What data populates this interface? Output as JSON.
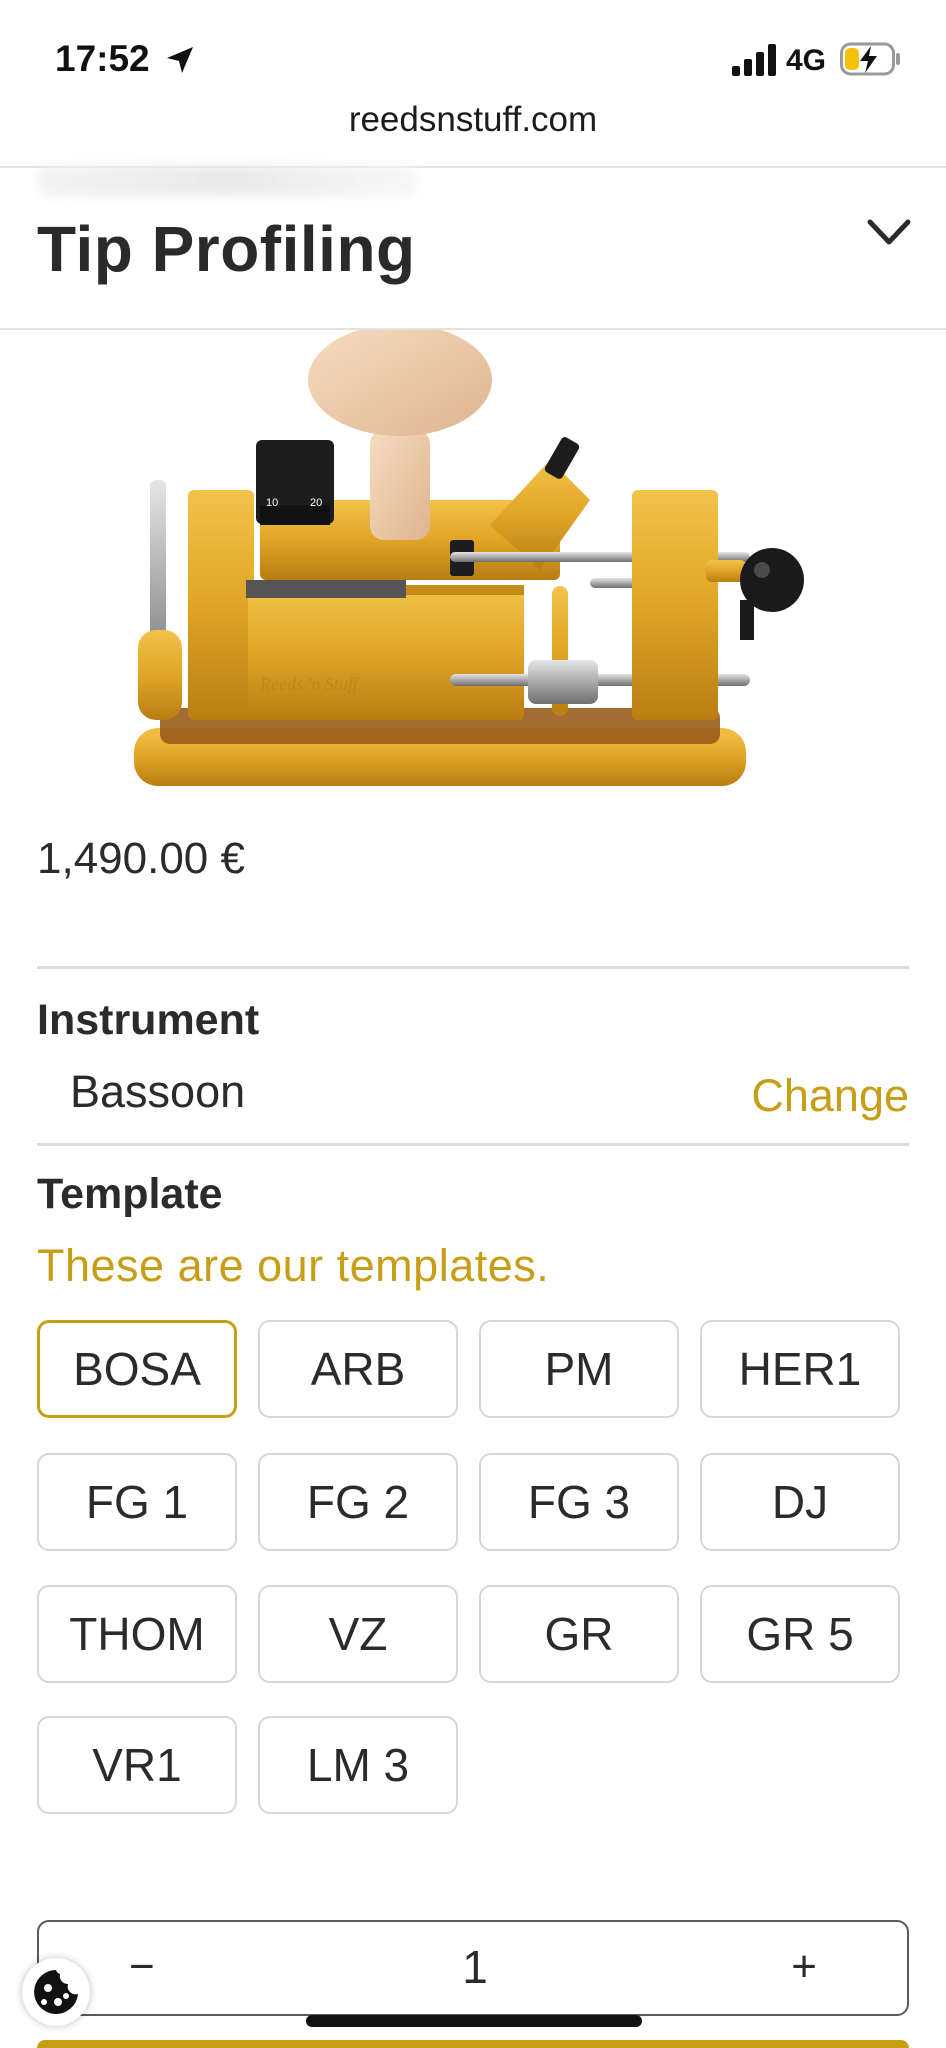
{
  "status_bar": {
    "time": "17:52",
    "network": "4G"
  },
  "browser": {
    "url": "reedsnstuff.com"
  },
  "header": {
    "title": "Tip Profiling"
  },
  "product": {
    "price": "1,490.00 €",
    "dial_labels": [
      "10",
      "20"
    ],
    "engraving": "Reeds 'n Stuff"
  },
  "instrument": {
    "label": "Instrument",
    "value": "Bassoon",
    "change_label": "Change"
  },
  "template": {
    "label": "Template",
    "description": "These are our templates.",
    "options": [
      "BOSA",
      "ARB",
      "PM",
      "HER1",
      "FG 1",
      "FG 2",
      "FG 3",
      "DJ",
      "THOM",
      "VZ",
      "GR",
      "GR 5",
      "VR1",
      "LM 3"
    ],
    "selected": "BOSA"
  },
  "quantity": {
    "minus": "−",
    "value": "1",
    "plus": "+"
  },
  "colors": {
    "accent": "#c89e17",
    "brass": "#e0a526",
    "text": "#2b2b2b"
  }
}
